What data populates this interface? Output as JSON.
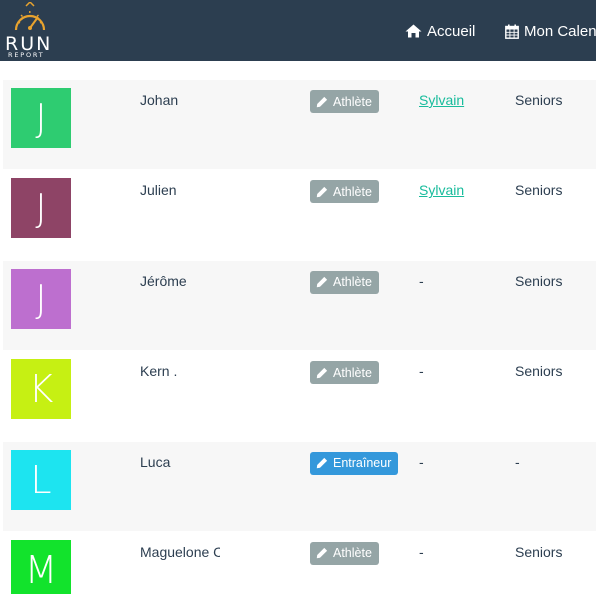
{
  "brand": {
    "logo_word": "RUN",
    "logo_sub": "REPORT"
  },
  "nav": {
    "home_label": "Accueil",
    "calendar_label": "Mon Calendrier"
  },
  "rows": [
    {
      "initial": "J",
      "color": "#2ecc71",
      "name": "Johan",
      "role": "Athlète",
      "role_type": "athlete",
      "coach": "Sylvain",
      "group": "Seniors"
    },
    {
      "initial": "J",
      "color": "#8e4466",
      "name": "Julien",
      "role": "Athlète",
      "role_type": "athlete",
      "coach": "Sylvain",
      "group": "Seniors"
    },
    {
      "initial": "J",
      "color": "#bd6fcf",
      "name": "Jérôme",
      "role": "Athlète",
      "role_type": "athlete",
      "coach": "-",
      "group": "Seniors"
    },
    {
      "initial": "K",
      "color": "#c6f013",
      "name": "Kern .",
      "role": "Athlète",
      "role_type": "athlete",
      "coach": "-",
      "group": "Seniors"
    },
    {
      "initial": "L",
      "color": "#1de4f0",
      "name": "Luca",
      "role": "Entraîneur",
      "role_type": "coach",
      "coach": "-",
      "group": "-"
    },
    {
      "initial": "M",
      "color": "#12e32c",
      "name": "Maguelone C",
      "role": "Athlète",
      "role_type": "athlete",
      "coach": "-",
      "group": "Seniors"
    }
  ]
}
